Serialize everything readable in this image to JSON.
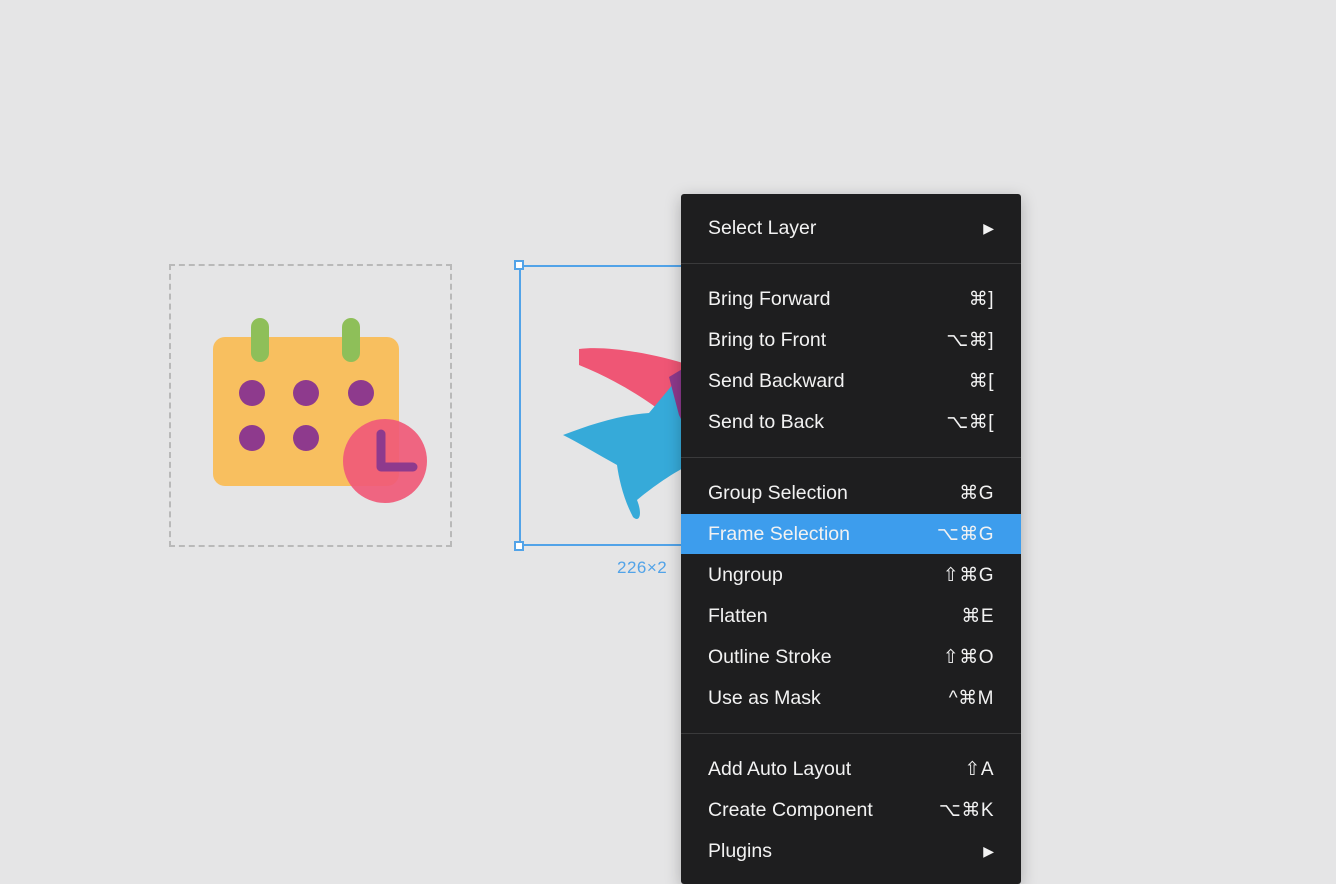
{
  "canvas": {
    "frame_size_label": "226×2"
  },
  "menu": {
    "groups": [
      [
        {
          "label": "Select Layer",
          "shortcut": "",
          "submenu": true
        }
      ],
      [
        {
          "label": "Bring Forward",
          "shortcut": "⌘]"
        },
        {
          "label": "Bring to Front",
          "shortcut": "⌥⌘]"
        },
        {
          "label": "Send Backward",
          "shortcut": "⌘["
        },
        {
          "label": "Send to Back",
          "shortcut": "⌥⌘["
        }
      ],
      [
        {
          "label": "Group Selection",
          "shortcut": "⌘G"
        },
        {
          "label": "Frame Selection",
          "shortcut": "⌥⌘G",
          "highlighted": true
        },
        {
          "label": "Ungroup",
          "shortcut": "⇧⌘G"
        },
        {
          "label": "Flatten",
          "shortcut": "⌘E"
        },
        {
          "label": "Outline Stroke",
          "shortcut": "⇧⌘O"
        },
        {
          "label": "Use as Mask",
          "shortcut": "^⌘M"
        }
      ],
      [
        {
          "label": "Add Auto Layout",
          "shortcut": "⇧A"
        },
        {
          "label": "Create Component",
          "shortcut": "⌥⌘K"
        },
        {
          "label": "Plugins",
          "shortcut": "",
          "submenu": true
        }
      ]
    ],
    "submenu_arrow": "▶"
  },
  "colors": {
    "selection": "#52a3e8",
    "menu_background": "#1e1e1f",
    "menu_highlight": "#3d9ded",
    "canvas": "#e5e5e6"
  },
  "icons": [
    "calendar-clock-icon",
    "airplane-icon",
    "submenu-arrow-icon"
  ]
}
